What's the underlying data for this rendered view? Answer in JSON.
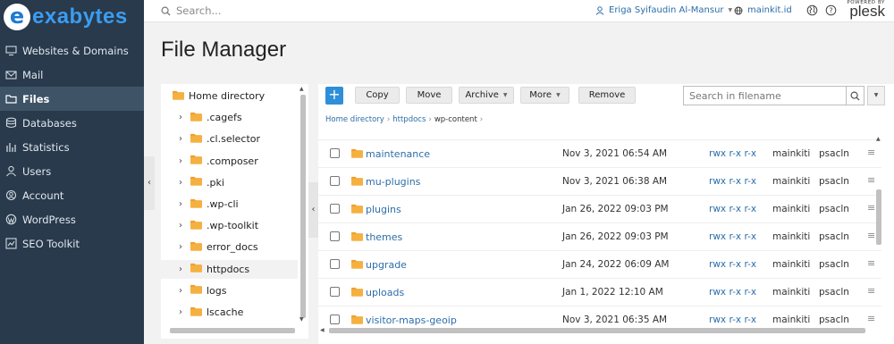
{
  "brand": {
    "logo_letter": "e",
    "logo_text": "exabytes"
  },
  "sidebar": {
    "items": [
      {
        "label": "Websites & Domains",
        "icon": "monitor-icon",
        "active": false
      },
      {
        "label": "Mail",
        "icon": "mail-icon",
        "active": false
      },
      {
        "label": "Files",
        "icon": "folder-icon",
        "active": true
      },
      {
        "label": "Databases",
        "icon": "database-icon",
        "active": false
      },
      {
        "label": "Statistics",
        "icon": "bar-chart-icon",
        "active": false
      },
      {
        "label": "Users",
        "icon": "user-icon",
        "active": false
      },
      {
        "label": "Account",
        "icon": "account-icon",
        "active": false
      },
      {
        "label": "WordPress",
        "icon": "wordpress-icon",
        "active": false
      },
      {
        "label": "SEO Toolkit",
        "icon": "seo-chart-icon",
        "active": false
      }
    ],
    "collapse_glyph": "‹"
  },
  "topbar": {
    "search_placeholder": "Search...",
    "user_name": "Eriga Syifaudin Al-Mansur",
    "domain": "mainkit.id",
    "powered_by": "POWERED BY",
    "plesk": "plesk"
  },
  "page": {
    "title": "File Manager"
  },
  "tree": {
    "items": [
      {
        "label": "Home directory",
        "expandable": false,
        "selected": false
      },
      {
        "label": ".cagefs",
        "expandable": true,
        "selected": false
      },
      {
        "label": ".cl.selector",
        "expandable": true,
        "selected": false
      },
      {
        "label": ".composer",
        "expandable": true,
        "selected": false
      },
      {
        "label": ".pki",
        "expandable": true,
        "selected": false
      },
      {
        "label": ".wp-cli",
        "expandable": true,
        "selected": false
      },
      {
        "label": ".wp-toolkit",
        "expandable": true,
        "selected": false
      },
      {
        "label": "error_docs",
        "expandable": true,
        "selected": false
      },
      {
        "label": "httpdocs",
        "expandable": true,
        "selected": true
      },
      {
        "label": "logs",
        "expandable": true,
        "selected": false
      },
      {
        "label": "lscache",
        "expandable": true,
        "selected": false
      }
    ],
    "collapse_glyph": "‹"
  },
  "toolbar": {
    "add_label": "+",
    "copy_label": "Copy",
    "move_label": "Move",
    "archive_label": "Archive",
    "more_label": "More",
    "remove_label": "Remove",
    "search_placeholder": "Search in filename"
  },
  "breadcrumb": {
    "items": [
      "Home directory",
      "httpdocs",
      "wp-content"
    ]
  },
  "files": [
    {
      "name": "maintenance",
      "modified": "Nov 3, 2021 06:54 AM",
      "permissions": "rwx r-x r-x",
      "owner": "mainkiti",
      "group": "psacln"
    },
    {
      "name": "mu-plugins",
      "modified": "Nov 3, 2021 06:38 AM",
      "permissions": "rwx r-x r-x",
      "owner": "mainkiti",
      "group": "psacln"
    },
    {
      "name": "plugins",
      "modified": "Jan 26, 2022 09:03 PM",
      "permissions": "rwx r-x r-x",
      "owner": "mainkiti",
      "group": "psacln"
    },
    {
      "name": "themes",
      "modified": "Jan 26, 2022 09:03 PM",
      "permissions": "rwx r-x r-x",
      "owner": "mainkiti",
      "group": "psacln"
    },
    {
      "name": "upgrade",
      "modified": "Jan 24, 2022 06:09 AM",
      "permissions": "rwx r-x r-x",
      "owner": "mainkiti",
      "group": "psacln"
    },
    {
      "name": "uploads",
      "modified": "Jan 1, 2022 12:10 AM",
      "permissions": "rwx r-x r-x",
      "owner": "mainkiti",
      "group": "psacln"
    },
    {
      "name": "visitor-maps-geoip",
      "modified": "Nov 3, 2021 06:35 AM",
      "permissions": "rwx r-x r-x",
      "owner": "mainkiti",
      "group": "psacln"
    }
  ],
  "colors": {
    "sidebar_bg": "#283a4c",
    "accent": "#2d8fd8",
    "link": "#2c6da9",
    "folder": "#f0a030"
  }
}
